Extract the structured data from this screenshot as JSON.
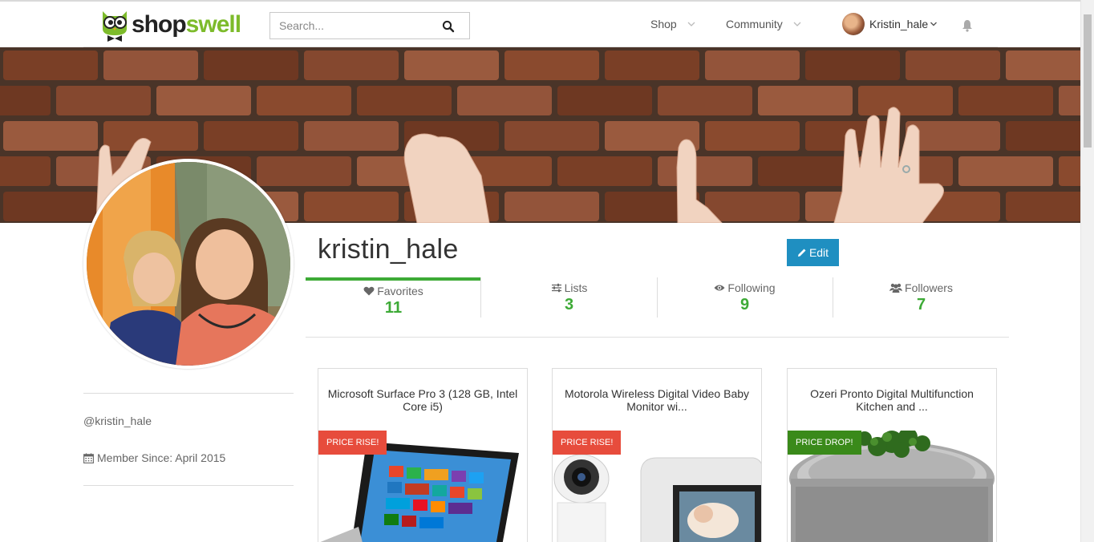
{
  "brand": {
    "shop": "shop",
    "swell": "swell"
  },
  "search": {
    "placeholder": "Search..."
  },
  "nav": {
    "shop": "Shop",
    "community": "Community",
    "user": "Kristin_hale"
  },
  "profile": {
    "username": "kristin_hale",
    "edit_label": "Edit",
    "handle": "@kristin_hale",
    "member_since": "Member Since: April 2015"
  },
  "stats": [
    {
      "label": "Favorites",
      "count": "11",
      "icon": "heart-icon",
      "active": true
    },
    {
      "label": "Lists",
      "count": "3",
      "icon": "sliders-icon",
      "active": false
    },
    {
      "label": "Following",
      "count": "9",
      "icon": "eye-icon",
      "active": false
    },
    {
      "label": "Followers",
      "count": "7",
      "icon": "users-icon",
      "active": false
    }
  ],
  "products": [
    {
      "title": "Microsoft Surface Pro 3 (128 GB, Intel Core i5)",
      "badge": "PRICE RISE!",
      "badge_color": "#e74c3c"
    },
    {
      "title": "Motorola Wireless Digital Video Baby Monitor wi...",
      "badge": "PRICE RISE!",
      "badge_color": "#e74c3c"
    },
    {
      "title": "Ozeri Pronto Digital Multifunction Kitchen and ...",
      "badge": "PRICE DROP!",
      "badge_color": "#3a8a1a"
    }
  ],
  "colors": {
    "accent_green": "#3daa36",
    "edit_blue": "#1f8fc1"
  }
}
